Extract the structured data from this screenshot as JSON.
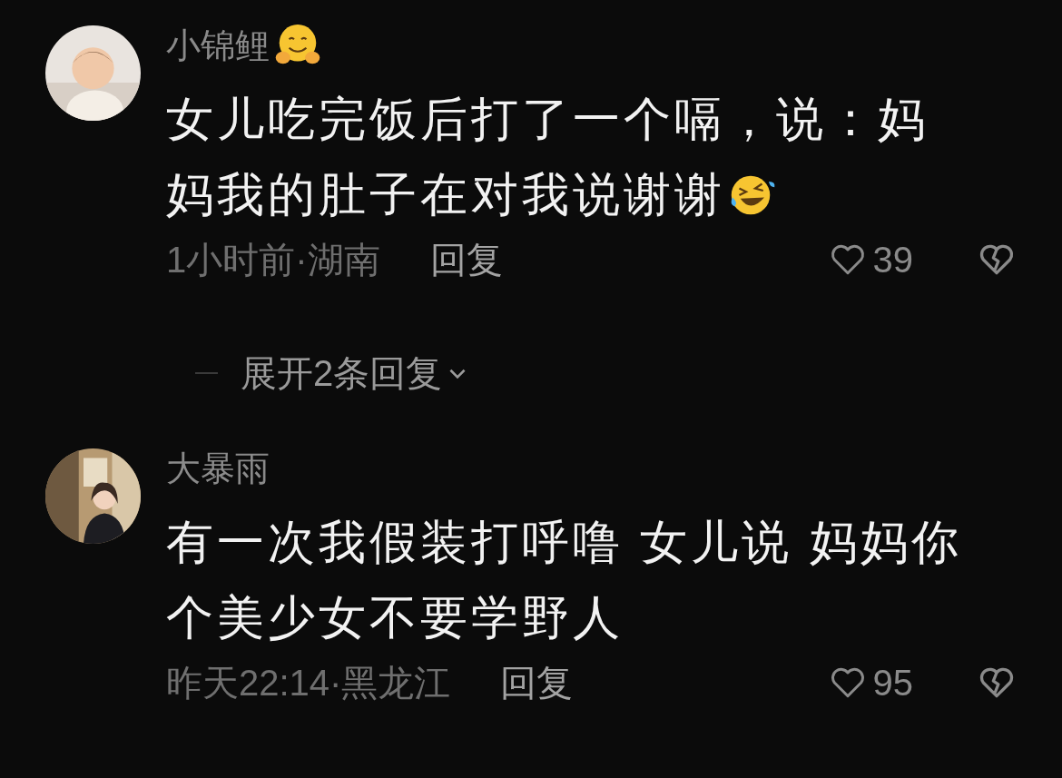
{
  "comments": [
    {
      "username": "小锦鲤",
      "text_lines": [
        "女儿吃完饭后打了一个嗝，说：妈",
        "妈我的肚子在对我说谢谢"
      ],
      "time_location": "1小时前·湖南",
      "reply_label": "回复",
      "likes": "39",
      "expand_replies": "展开2条回复"
    },
    {
      "username": "大暴雨",
      "text_lines": [
        "有一次我假装打呼噜 女儿说 妈妈你",
        "个美少女不要学野人"
      ],
      "time_location": "昨天22:14·黑龙江",
      "reply_label": "回复",
      "likes": "95"
    }
  ]
}
